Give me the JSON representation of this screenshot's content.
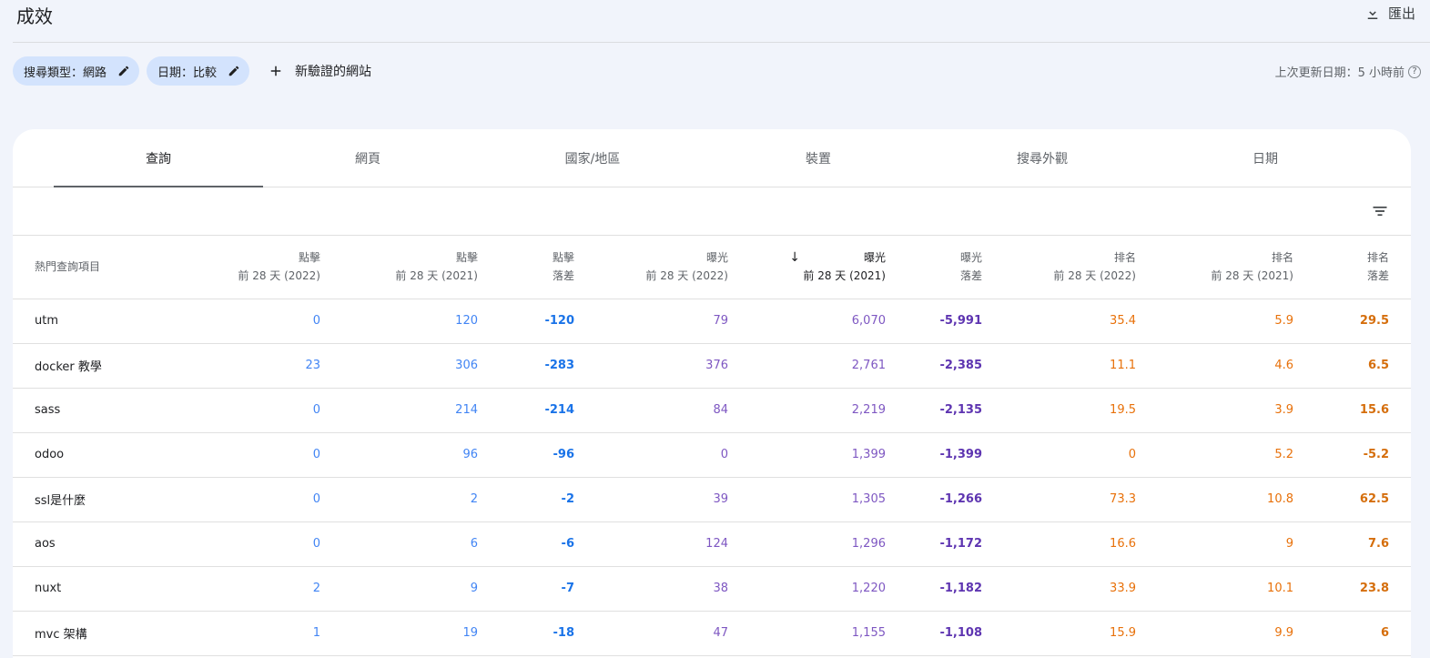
{
  "header": {
    "title": "成效",
    "export_label": "匯出"
  },
  "chips": {
    "search_type": "搜尋類型：網路",
    "date": "日期：比較",
    "add_site": "新驗證的網站"
  },
  "last_update": "上次更新日期：5 小時前",
  "help_glyph": "?",
  "tabs": [
    {
      "label": "查詢"
    },
    {
      "label": "網頁"
    },
    {
      "label": "國家/地區"
    },
    {
      "label": "裝置"
    },
    {
      "label": "搜尋外觀"
    },
    {
      "label": "日期"
    }
  ],
  "table": {
    "headers": [
      {
        "line1": "熱門查詢項目",
        "line2": ""
      },
      {
        "line1": "點擊",
        "line2": "前 28 天 (2022)"
      },
      {
        "line1": "點擊",
        "line2": "前 28 天 (2021)"
      },
      {
        "line1": "點擊",
        "line2": "落差"
      },
      {
        "line1": "曝光",
        "line2": "前 28 天 (2022)"
      },
      {
        "line1": "曝光",
        "line2": "前 28 天 (2021)"
      },
      {
        "line1": "曝光",
        "line2": "落差"
      },
      {
        "line1": "排名",
        "line2": "前 28 天 (2022)"
      },
      {
        "line1": "排名",
        "line2": "前 28 天 (2021)"
      },
      {
        "line1": "排名",
        "line2": "落差"
      }
    ],
    "sort_arrow": "↓",
    "rows": [
      [
        "utm",
        "0",
        "120",
        "-120",
        "79",
        "6,070",
        "-5,991",
        "35.4",
        "5.9",
        "29.5"
      ],
      [
        "docker 教學",
        "23",
        "306",
        "-283",
        "376",
        "2,761",
        "-2,385",
        "11.1",
        "4.6",
        "6.5"
      ],
      [
        "sass",
        "0",
        "214",
        "-214",
        "84",
        "2,219",
        "-2,135",
        "19.5",
        "3.9",
        "15.6"
      ],
      [
        "odoo",
        "0",
        "96",
        "-96",
        "0",
        "1,399",
        "-1,399",
        "0",
        "5.2",
        "-5.2"
      ],
      [
        "ssl是什麼",
        "0",
        "2",
        "-2",
        "39",
        "1,305",
        "-1,266",
        "73.3",
        "10.8",
        "62.5"
      ],
      [
        "aos",
        "0",
        "6",
        "-6",
        "124",
        "1,296",
        "-1,172",
        "16.6",
        "9",
        "7.6"
      ],
      [
        "nuxt",
        "2",
        "9",
        "-7",
        "38",
        "1,220",
        "-1,182",
        "33.9",
        "10.1",
        "23.8"
      ],
      [
        "mvc 架構",
        "1",
        "19",
        "-18",
        "47",
        "1,155",
        "-1,108",
        "15.9",
        "9.9",
        "6"
      ]
    ]
  },
  "colors": {
    "clicks": "#4285f4",
    "impressions": "#7e57c2",
    "position": "#e8710a",
    "chip_bg": "#d3e3fd",
    "page_bg": "#f1f4fb"
  }
}
